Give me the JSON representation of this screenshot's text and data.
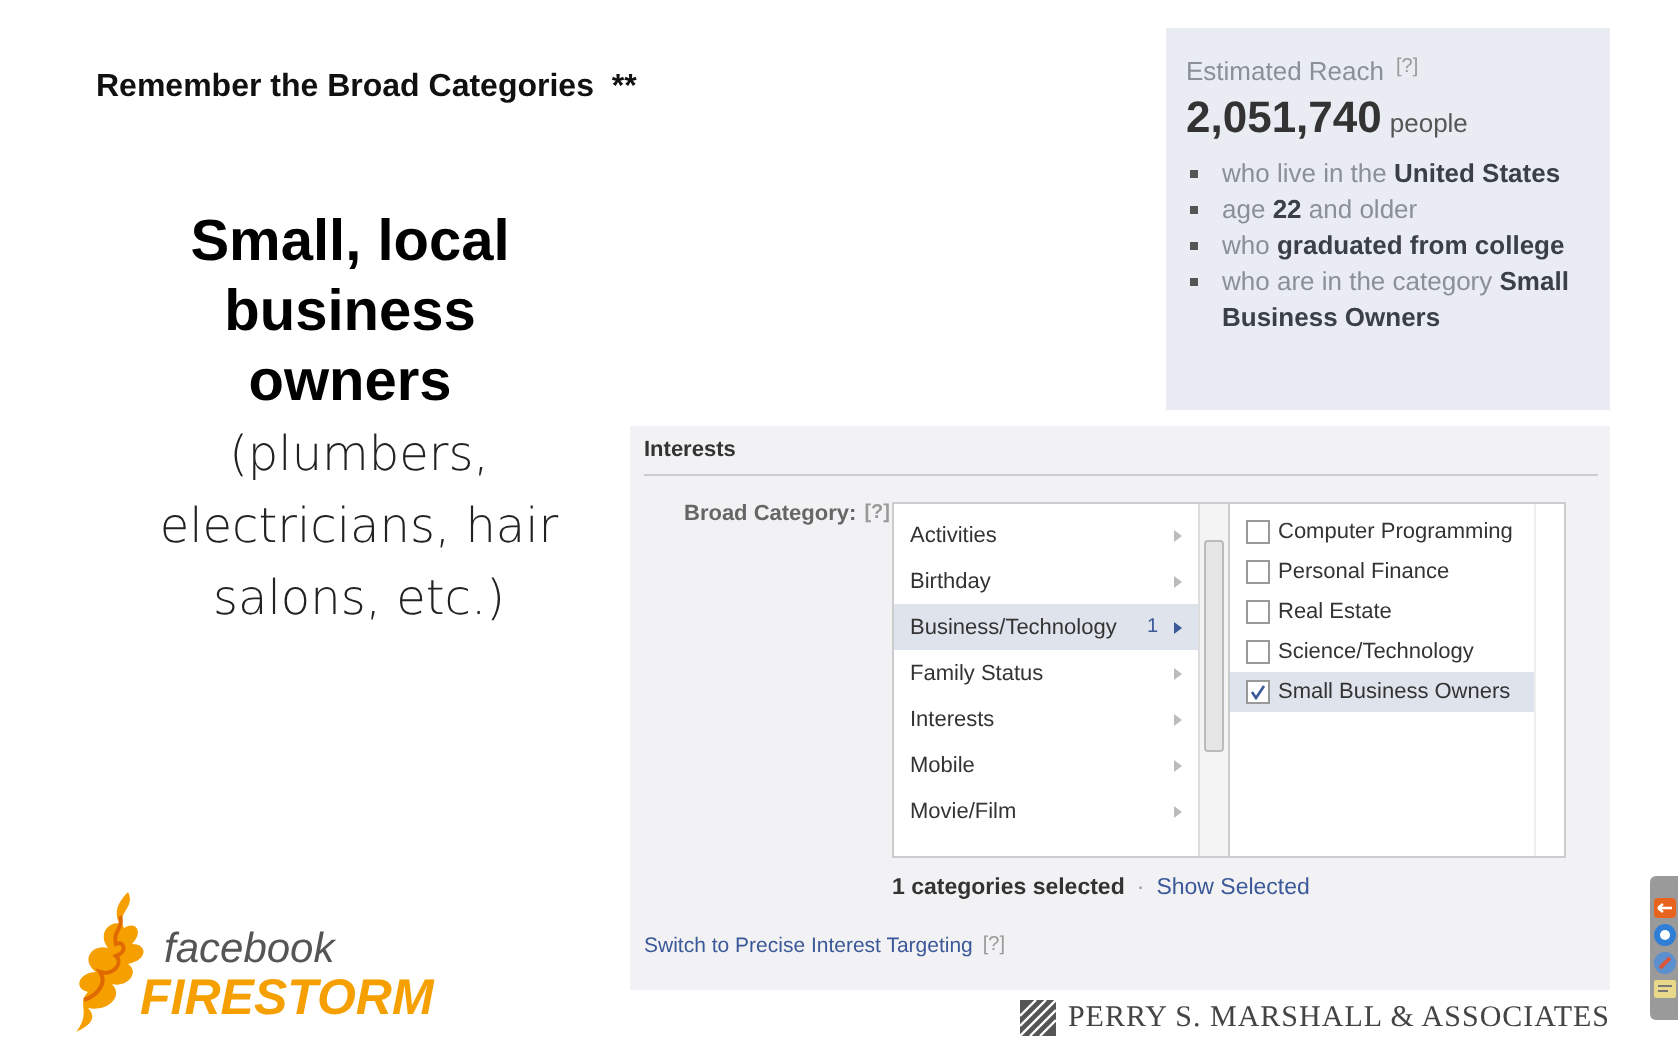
{
  "title": "Remember the Broad Categories  **",
  "headline": "Small, local business owners",
  "subtext": "(plumbers, electricians, hair salons, etc.)",
  "reach": {
    "label": "Estimated Reach",
    "help": "[?]",
    "count": "2,051,740",
    "unit": "people",
    "criteria": [
      "who live in the **United States**",
      "age **22** and older",
      "who **graduated from college**",
      "who are in the category **Small Business Owners**"
    ]
  },
  "interests": {
    "heading": "Interests",
    "field_label": "Broad Category:",
    "help": "[?]",
    "categories": [
      {
        "label": "Activities",
        "selected": false
      },
      {
        "label": "Birthday",
        "selected": false
      },
      {
        "label": "Business/Technology",
        "count": "1",
        "selected": true
      },
      {
        "label": "Family Status",
        "selected": false
      },
      {
        "label": "Interests",
        "selected": false
      },
      {
        "label": "Mobile",
        "selected": false
      },
      {
        "label": "Movie/Film",
        "selected": false
      }
    ],
    "options": [
      {
        "label": "Computer Programming",
        "checked": false
      },
      {
        "label": "Personal Finance",
        "checked": false
      },
      {
        "label": "Real Estate",
        "checked": false
      },
      {
        "label": "Science/Technology",
        "checked": false
      },
      {
        "label": "Small Business Owners",
        "checked": true
      }
    ],
    "summary": "1 categories selected",
    "separator": "·",
    "show_link": "Show Selected",
    "switch_link": "Switch to Precise Interest Targeting",
    "switch_help": "[?]"
  },
  "logo": {
    "top": "facebook",
    "bottom": "FIRESTORM"
  },
  "footer": "PERRY S. MARSHALL & ASSOCIATES"
}
